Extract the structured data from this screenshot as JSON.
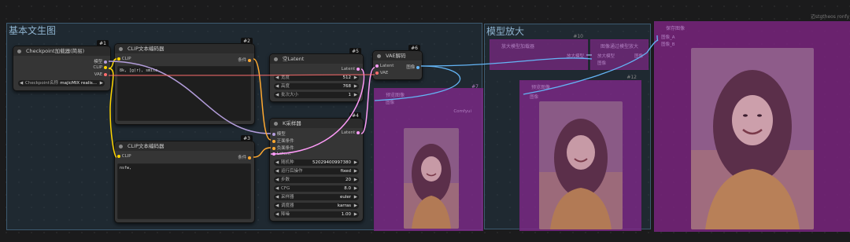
{
  "watermark": "迈stgtheos ronfy",
  "groups": {
    "txt2img": "基本文生图",
    "upscale": "模型放大"
  },
  "nodes": {
    "checkpoint": {
      "title": "Checkpoint加载器(简易)",
      "badge": "#1",
      "out_model": "模型",
      "out_clip": "CLIP",
      "out_vae": "VAE",
      "w_label": "Checkpoint名称",
      "w_value": "majicMIX realis..."
    },
    "clip_pos": {
      "title": "CLIP文本编码器",
      "badge": "#2",
      "in_clip": "CLIP",
      "out": "条件",
      "text": "8k, [g(r), smile,"
    },
    "clip_neg": {
      "title": "CLIP文本编码器",
      "badge": "#3",
      "in_clip": "CLIP",
      "out": "条件",
      "text": "nsfw,"
    },
    "latent": {
      "title": "空Latent",
      "badge": "#5",
      "out": "Latent",
      "widgets": [
        {
          "label": "宽度",
          "value": "512"
        },
        {
          "label": "高度",
          "value": "768"
        },
        {
          "label": "批次大小",
          "value": "1"
        }
      ]
    },
    "ksampler": {
      "title": "K采样器",
      "badge": "#4",
      "in_model": "模型",
      "in_pos": "正面条件",
      "in_neg": "负面条件",
      "in_latent": "Latent",
      "out": "Latent",
      "widgets": [
        {
          "label": "随机种",
          "value": "52029400997380"
        },
        {
          "label": "运行后操作",
          "value": "fixed"
        },
        {
          "label": "步数",
          "value": "20"
        },
        {
          "label": "CFG",
          "value": "8.0"
        },
        {
          "label": "采样器",
          "value": "euler"
        },
        {
          "label": "调度器",
          "value": "karras"
        },
        {
          "label": "降噪",
          "value": "1.00"
        }
      ]
    },
    "vae_decode": {
      "title": "VAE解码",
      "badge": "#6",
      "in_latent": "Latent",
      "in_vae": "VAE",
      "out": "图像"
    },
    "preview": {
      "title": "预览图像",
      "badge": "#7",
      "sub_left": "图像",
      "sub_right": "Comfyui"
    },
    "upscale_loader": {
      "title": "放大模型加载器",
      "badge": "#10",
      "out": "放大模型"
    },
    "upscale_img": {
      "title": "图像通过模型放大",
      "in_model": "放大模型",
      "in_img": "图像",
      "out": "图像"
    },
    "preview2": {
      "title": "预览图像",
      "badge": "#12",
      "in_img": "图像"
    },
    "save": {
      "title": "保存图像",
      "in_a": "图像_A",
      "in_b": "图像_B"
    }
  },
  "colors": {
    "model": "#b39ddb",
    "clip": "#ffd500",
    "vae": "#ff6e6e",
    "cond": "#ffa931",
    "latent": "#ff9cf9",
    "image": "#64b5f6"
  }
}
